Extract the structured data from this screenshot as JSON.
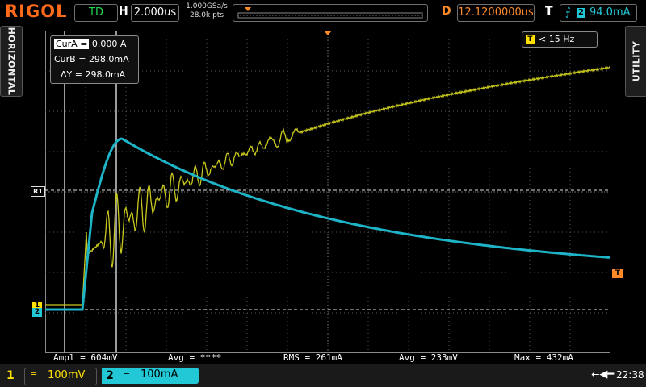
{
  "brand": "RIGOL",
  "header": {
    "trigger_status": "TD",
    "h_label": "H",
    "timebase": "2.000us",
    "sample_rate": "1.000GSa/s",
    "memory_points": "28.0k pts",
    "d_label": "D",
    "delay": "12.1200000us",
    "t_label": "T",
    "trigger_edge_icon": "rising-edge-icon",
    "trigger_source": "2",
    "trigger_level": "94.0mA"
  },
  "side_tabs": {
    "left": "HORIZONTAL",
    "right": "UTILITY"
  },
  "cursor_readout": {
    "cura_label": "CurA =",
    "cura_value": "0.000 A",
    "curb_label": "CurB =",
    "curb_value": "298.0mA",
    "dy_label": "ΔY =",
    "dy_value": "298.0mA"
  },
  "freq_counter": {
    "icon_label": "T",
    "value": "< 15 Hz"
  },
  "markers": {
    "ref_label": "R1",
    "trigger_level_label": "T",
    "ch1_label": "1",
    "ch2_label": "2"
  },
  "measurements": [
    {
      "text": "Ampl = 604mV",
      "color": "#ffe000"
    },
    {
      "text": "Avg = ****",
      "color": "#8866ff"
    },
    {
      "text": "RMS = 261mA",
      "color": "#22d6e6"
    },
    {
      "text": "Avg = 233mV",
      "color": "#ffe000"
    },
    {
      "text": "Max = 432mA",
      "color": "#22d6e6"
    }
  ],
  "channels": {
    "ch1": {
      "number": "1",
      "scale": "100mV",
      "color": "#ffe000"
    },
    "ch2": {
      "number": "2",
      "scale": "100mA",
      "color": "#22c8d6"
    }
  },
  "status": {
    "usb_icon": "usb-icon",
    "time": "22:38"
  },
  "colors": {
    "ch1": "#c8c81e",
    "ch2": "#1eb4c8",
    "trigger": "#ff8a2a",
    "grid": "#8a8a8a"
  }
}
